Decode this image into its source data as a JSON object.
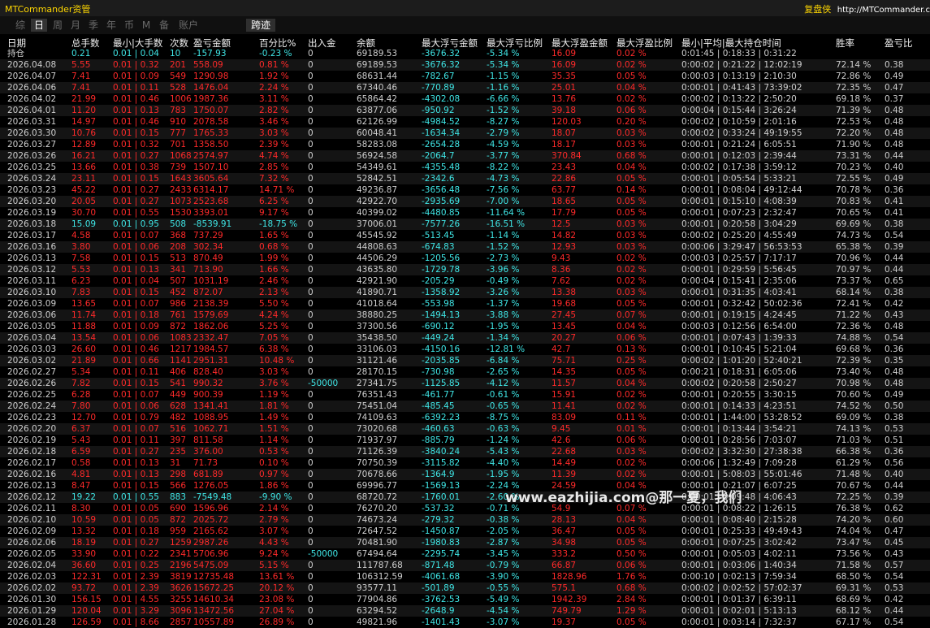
{
  "app": {
    "title": "MTCommander资管",
    "brand": "复盘侠",
    "url": "http://MTCommander.c"
  },
  "toolbar": {
    "timeframes": [
      "综",
      "日",
      "周",
      "月",
      "季",
      "年",
      "币",
      "M",
      "备",
      "账户"
    ],
    "active": "日",
    "selection": "跨迹"
  },
  "colors": {
    "profit": "#ff2a2a",
    "loss": "#3fe6e6",
    "neutral": "#cfcfcf",
    "brand": "#ffd700"
  },
  "columns": [
    "日期",
    "总手数",
    "最小|大手数",
    "次数",
    "盈亏金额",
    "百分比%",
    "出入金",
    "余额",
    "最大浮亏金额",
    "最大浮亏比例",
    "最大浮盈金额",
    "最大浮盈比例",
    "最小|平均|最大持仓时间",
    "胜率",
    "盈亏比"
  ],
  "position_row": [
    "持仓",
    "0.21",
    "0.01 | 0.04",
    "10",
    "-157.93",
    "-0.23 %",
    "0",
    "69189.53",
    "-3676.32",
    "-5.34 %",
    "16.09",
    "0.02 %",
    "0:01:45 | 0:18:33 | 0:31:22",
    "",
    ""
  ],
  "rows": [
    [
      "2026.04.08",
      "5.55",
      "0.01 | 0.32",
      "201",
      "558.09",
      "0.81 %",
      "0",
      "69189.53",
      "-3676.32",
      "-5.34 %",
      "16.09",
      "0.02 %",
      "0:00:02 | 0:21:22 | 12:02:19",
      "72.14 %",
      "0.38"
    ],
    [
      "2026.04.07",
      "7.41",
      "0.01 | 0.09",
      "549",
      "1290.98",
      "1.92 %",
      "0",
      "68631.44",
      "-782.67",
      "-1.15 %",
      "35.35",
      "0.05 %",
      "0:00:03 | 0:13:19 | 2:10:30",
      "72.86 %",
      "0.49"
    ],
    [
      "2026.04.06",
      "7.41",
      "0.01 | 0.11",
      "528",
      "1476.04",
      "2.24 %",
      "0",
      "67340.46",
      "-770.89",
      "-1.16 %",
      "25.01",
      "0.04 %",
      "0:00:01 | 0:41:43 | 73:39:02",
      "72.35 %",
      "0.47"
    ],
    [
      "2026.04.02",
      "21.99",
      "0.01 | 0.46",
      "1006",
      "1987.36",
      "3.11 %",
      "0",
      "65864.42",
      "-4302.08",
      "-6.66 %",
      "13.76",
      "0.02 %",
      "0:00:02 | 0:13:22 | 2:50:20",
      "69.18 %",
      "0.37"
    ],
    [
      "2026.04.01",
      "11.20",
      "0.01 | 0.13",
      "783",
      "1750.07",
      "2.82 %",
      "0",
      "63877.06",
      "-950.92",
      "-1.52 %",
      "39.18",
      "0.06 %",
      "0:00:04 | 0:15:44 | 3:26:24",
      "71.39 %",
      "0.48"
    ],
    [
      "2026.03.31",
      "14.97",
      "0.01 | 0.46",
      "910",
      "2078.58",
      "3.46 %",
      "0",
      "62126.99",
      "-4984.52",
      "-8.27 %",
      "120.03",
      "0.20 %",
      "0:00:02 | 0:10:59 | 2:01:16",
      "72.53 %",
      "0.48"
    ],
    [
      "2026.03.30",
      "10.76",
      "0.01 | 0.15",
      "777",
      "1765.33",
      "3.03 %",
      "0",
      "60048.41",
      "-1634.34",
      "-2.79 %",
      "18.07",
      "0.03 %",
      "0:00:02 | 0:33:24 | 49:19:55",
      "72.20 %",
      "0.48"
    ],
    [
      "2026.03.27",
      "12.89",
      "0.01 | 0.32",
      "701",
      "1358.50",
      "2.39 %",
      "0",
      "58283.08",
      "-2654.28",
      "-4.59 %",
      "18.17",
      "0.03 %",
      "0:00:01 | 0:21:24 | 6:05:51",
      "71.90 %",
      "0.48"
    ],
    [
      "2026.03.26",
      "16.21",
      "0.01 | 0.27",
      "1068",
      "2574.97",
      "4.74 %",
      "0",
      "56924.58",
      "-2064.7",
      "-3.77 %",
      "370.84",
      "0.68 %",
      "0:00:01 | 0:12:03 | 2:39:44",
      "73.31 %",
      "0.44"
    ],
    [
      "2026.03.25",
      "13.66",
      "0.01 | 0.38",
      "739",
      "1507.10",
      "2.85 %",
      "0",
      "54349.61",
      "-4355.48",
      "-8.22 %",
      "23.43",
      "0.04 %",
      "0:00:02 | 0:17:38 | 3:59:12",
      "70.23 %",
      "0.40"
    ],
    [
      "2026.03.24",
      "23.11",
      "0.01 | 0.15",
      "1643",
      "3605.64",
      "7.32 %",
      "0",
      "52842.51",
      "-2342.6",
      "-4.73 %",
      "22.86",
      "0.05 %",
      "0:00:01 | 0:05:54 | 5:33:21",
      "72.55 %",
      "0.49"
    ],
    [
      "2026.03.23",
      "45.22",
      "0.01 | 0.27",
      "2433",
      "6314.17",
      "14.71 %",
      "0",
      "49236.87",
      "-3656.48",
      "-7.56 %",
      "63.77",
      "0.14 %",
      "0:00:01 | 0:08:04 | 49:12:44",
      "70.78 %",
      "0.36"
    ],
    [
      "2026.03.20",
      "20.05",
      "0.01 | 0.27",
      "1073",
      "2523.68",
      "6.25 %",
      "0",
      "42922.70",
      "-2935.69",
      "-7.00 %",
      "18.65",
      "0.05 %",
      "0:00:01 | 0:15:10 | 4:08:39",
      "70.83 %",
      "0.41"
    ],
    [
      "2026.03.19",
      "30.70",
      "0.01 | 0.55",
      "1530",
      "3393.01",
      "9.17 %",
      "0",
      "40399.02",
      "-4480.85",
      "-11.64 %",
      "17.79",
      "0.05 %",
      "0:00:01 | 0:07:23 | 2:32:47",
      "70.65 %",
      "0.41"
    ],
    [
      "2026.03.18",
      "15.09",
      "0.01 | 0.95",
      "508",
      "-8539.91",
      "-18.75 %",
      "0",
      "37006.01",
      "-7577.26",
      "-16.51 %",
      "12.5",
      "0.03 %",
      "0:00:01 | 0:20:58 | 3:04:29",
      "69.69 %",
      "0.38"
    ],
    [
      "2026.03.17",
      "4.58",
      "0.01 | 0.07",
      "368",
      "737.29",
      "1.65 %",
      "0",
      "45545.92",
      "-513.45",
      "-1.14 %",
      "14.82",
      "0.03 %",
      "0:00:02 | 0:25:20 | 4:55:49",
      "74.73 %",
      "0.54"
    ],
    [
      "2026.03.16",
      "3.80",
      "0.01 | 0.06",
      "208",
      "302.34",
      "0.68 %",
      "0",
      "44808.63",
      "-674.83",
      "-1.52 %",
      "12.93",
      "0.03 %",
      "0:00:06 | 3:29:47 | 56:53:53",
      "65.38 %",
      "0.39"
    ],
    [
      "2026.03.13",
      "7.58",
      "0.01 | 0.15",
      "513",
      "870.49",
      "1.99 %",
      "0",
      "44506.29",
      "-1205.56",
      "-2.73 %",
      "9.43",
      "0.02 %",
      "0:00:03 | 0:25:57 | 7:17:17",
      "70.96 %",
      "0.44"
    ],
    [
      "2026.03.12",
      "5.53",
      "0.01 | 0.13",
      "341",
      "713.90",
      "1.66 %",
      "0",
      "43635.80",
      "-1729.78",
      "-3.96 %",
      "8.36",
      "0.02 %",
      "0:00:01 | 0:29:59 | 5:56:45",
      "70.97 %",
      "0.44"
    ],
    [
      "2026.03.11",
      "6.23",
      "0.01 | 0.04",
      "507",
      "1031.19",
      "2.46 %",
      "0",
      "42921.90",
      "-205.29",
      "-0.49 %",
      "7.62",
      "0.02 %",
      "0:00:04 | 0:15:41 | 2:35:06",
      "73.37 %",
      "0.65"
    ],
    [
      "2026.03.10",
      "7.83",
      "0.01 | 0.15",
      "452",
      "872.07",
      "2.13 %",
      "0",
      "41890.71",
      "-1358.92",
      "-3.26 %",
      "13.38",
      "0.03 %",
      "0:00:01 | 0:31:35 | 4:03:41",
      "68.14 %",
      "0.38"
    ],
    [
      "2026.03.09",
      "13.65",
      "0.01 | 0.07",
      "986",
      "2138.39",
      "5.50 %",
      "0",
      "41018.64",
      "-553.98",
      "-1.37 %",
      "19.68",
      "0.05 %",
      "0:00:01 | 0:32:42 | 50:02:36",
      "72.41 %",
      "0.42"
    ],
    [
      "2026.03.06",
      "11.74",
      "0.01 | 0.18",
      "761",
      "1579.69",
      "4.24 %",
      "0",
      "38880.25",
      "-1494.13",
      "-3.88 %",
      "27.45",
      "0.07 %",
      "0:00:01 | 0:19:15 | 4:24:45",
      "71.22 %",
      "0.43"
    ],
    [
      "2026.03.05",
      "11.88",
      "0.01 | 0.09",
      "872",
      "1862.06",
      "5.25 %",
      "0",
      "37300.56",
      "-690.12",
      "-1.95 %",
      "13.45",
      "0.04 %",
      "0:00:03 | 0:12:56 | 6:54:00",
      "72.36 %",
      "0.48"
    ],
    [
      "2026.03.04",
      "13.54",
      "0.01 | 0.06",
      "1083",
      "2332.47",
      "7.05 %",
      "0",
      "35438.50",
      "-449.24",
      "-1.34 %",
      "20.27",
      "0.06 %",
      "0:00:01 | 0:07:43 | 1:39:33",
      "74.88 %",
      "0.54"
    ],
    [
      "2026.03.03",
      "26.60",
      "0.01 | 0.46",
      "1217",
      "1984.57",
      "6.38 %",
      "0",
      "33106.03",
      "-4150.16",
      "-12.81 %",
      "42.7",
      "0.13 %",
      "0:00:01 | 0:10:45 | 5:21:04",
      "69.68 %",
      "0.36"
    ],
    [
      "2026.03.02",
      "21.89",
      "0.01 | 0.66",
      "1141",
      "2951.31",
      "10.48 %",
      "0",
      "31121.46",
      "-2035.85",
      "-6.84 %",
      "75.71",
      "0.25 %",
      "0:00:02 | 1:01:20 | 52:40:21",
      "72.39 %",
      "0.35"
    ],
    [
      "2026.02.27",
      "5.34",
      "0.01 | 0.11",
      "406",
      "828.40",
      "3.03 %",
      "0",
      "28170.15",
      "-730.98",
      "-2.65 %",
      "14.35",
      "0.05 %",
      "0:00:21 | 0:18:31 | 6:05:06",
      "73.40 %",
      "0.48"
    ],
    [
      "2026.02.26",
      "7.82",
      "0.01 | 0.15",
      "541",
      "990.32",
      "3.76 %",
      "-50000",
      "27341.75",
      "-1125.85",
      "-4.12 %",
      "11.57",
      "0.04 %",
      "0:00:02 | 0:20:58 | 2:50:27",
      "70.98 %",
      "0.48"
    ],
    [
      "2026.02.25",
      "6.28",
      "0.01 | 0.07",
      "449",
      "900.39",
      "1.19 %",
      "0",
      "76351.43",
      "-461.77",
      "-0.61 %",
      "15.91",
      "0.02 %",
      "0:00:01 | 0:20:55 | 3:30:15",
      "70.60 %",
      "0.49"
    ],
    [
      "2026.02.24",
      "7.80",
      "0.01 | 0.06",
      "628",
      "1341.41",
      "1.81 %",
      "0",
      "75451.04",
      "-485.45",
      "-0.65 %",
      "11.41",
      "0.02 %",
      "0:00:01 | 0:14:33 | 4:23:51",
      "74.52 %",
      "0.50"
    ],
    [
      "2026.02.23",
      "12.70",
      "0.01 | 0.79",
      "482",
      "1088.95",
      "1.49 %",
      "0",
      "74109.63",
      "-6392.23",
      "-8.75 %",
      "83.09",
      "0.11 %",
      "0:00:01 | 1:44:00 | 53:28:52",
      "69.09 %",
      "0.38"
    ],
    [
      "2026.02.20",
      "6.37",
      "0.01 | 0.07",
      "516",
      "1062.71",
      "1.51 %",
      "0",
      "73020.68",
      "-460.63",
      "-0.63 %",
      "9.45",
      "0.01 %",
      "0:00:01 | 0:13:44 | 3:54:21",
      "74.13 %",
      "0.53"
    ],
    [
      "2026.02.19",
      "5.43",
      "0.01 | 0.11",
      "397",
      "811.58",
      "1.14 %",
      "0",
      "71937.97",
      "-885.79",
      "-1.24 %",
      "42.6",
      "0.06 %",
      "0:00:01 | 0:28:56 | 7:03:07",
      "71.03 %",
      "0.51"
    ],
    [
      "2026.02.18",
      "6.59",
      "0.01 | 0.27",
      "235",
      "376.00",
      "0.53 %",
      "0",
      "71126.39",
      "-3840.24",
      "-5.43 %",
      "22.68",
      "0.03 %",
      "0:00:02 | 3:32:30 | 27:38:38",
      "66.38 %",
      "0.36"
    ],
    [
      "2026.02.17",
      "0.58",
      "0.01 | 0.13",
      "31",
      "71.73",
      "0.10 %",
      "0",
      "70750.39",
      "-3115.82",
      "-4.40 %",
      "14.49",
      "0.02 %",
      "0:00:06 | 1:32:49 | 7:09:28",
      "61.29 %",
      "0.56"
    ],
    [
      "2026.02.16",
      "4.81",
      "0.01 | 0.13",
      "298",
      "681.89",
      "0.97 %",
      "0",
      "70678.66",
      "-1364.9",
      "-1.95 %",
      "11.39",
      "0.02 %",
      "0:00:01 | 5:08:03 | 55:01:46",
      "71.48 %",
      "0.40"
    ],
    [
      "2026.02.13",
      "8.47",
      "0.01 | 0.15",
      "566",
      "1276.05",
      "1.86 %",
      "0",
      "69996.77",
      "-1569.13",
      "-2.24 %",
      "24.59",
      "0.04 %",
      "0:00:01 | 0:21:07 | 6:07:25",
      "70.67 %",
      "0.44"
    ],
    [
      "2026.02.12",
      "19.22",
      "0.01 | 0.55",
      "883",
      "-7549.48",
      "-9.90 %",
      "0",
      "68720.72",
      "-1760.01",
      "-2.60 %",
      "",
      "",
      "0:00:01 | 0:09:48 | 4:06:43",
      "72.25 %",
      "0.39"
    ],
    [
      "2026.02.11",
      "8.30",
      "0.01 | 0.05",
      "690",
      "1596.96",
      "2.14 %",
      "0",
      "76270.20",
      "-537.32",
      "-0.71 %",
      "54.9",
      "0.07 %",
      "0:00:01 | 0:08:22 | 1:26:15",
      "76.38 %",
      "0.62"
    ],
    [
      "2026.02.10",
      "10.59",
      "0.01 | 0.05",
      "872",
      "2025.72",
      "2.79 %",
      "0",
      "74673.24",
      "-279.32",
      "-0.38 %",
      "28.13",
      "0.04 %",
      "0:00:01 | 0:08:40 | 2:15:28",
      "74.20 %",
      "0.60"
    ],
    [
      "2026.02.09",
      "13.32",
      "0.01 | 0.18",
      "959",
      "2165.62",
      "3.07 %",
      "0",
      "72647.52",
      "-1450.87",
      "-2.05 %",
      "36.47",
      "0.05 %",
      "0:00:01 | 0:25:33 | 49:49:43",
      "74.04 %",
      "0.47"
    ],
    [
      "2026.02.06",
      "18.19",
      "0.01 | 0.27",
      "1259",
      "2987.26",
      "4.43 %",
      "0",
      "70481.90",
      "-1980.83",
      "-2.87 %",
      "34.98",
      "0.05 %",
      "0:00:01 | 0:07:25 | 3:02:42",
      "73.47 %",
      "0.45"
    ],
    [
      "2026.02.05",
      "33.90",
      "0.01 | 0.22",
      "2341",
      "5706.96",
      "9.24 %",
      "-50000",
      "67494.64",
      "-2295.74",
      "-3.45 %",
      "333.2",
      "0.50 %",
      "0:00:01 | 0:05:03 | 4:02:11",
      "73.56 %",
      "0.43"
    ],
    [
      "2026.02.04",
      "36.60",
      "0.01 | 0.25",
      "2196",
      "5475.09",
      "5.15 %",
      "0",
      "111787.68",
      "-871.48",
      "-0.79 %",
      "66.87",
      "0.06 %",
      "0:00:01 | 0:03:06 | 1:40:34",
      "71.58 %",
      "0.57"
    ],
    [
      "2026.02.03",
      "122.31",
      "0.01 | 2.39",
      "3819",
      "12735.48",
      "13.61 %",
      "0",
      "106312.59",
      "-4061.68",
      "-3.90 %",
      "1828.96",
      "1.76 %",
      "0:00:10 | 0:02:13 | 7:59:34",
      "68.50 %",
      "0.54"
    ],
    [
      "2026.02.02",
      "93.72",
      "0.01 | 2.39",
      "3626",
      "15672.25",
      "20.12 %",
      "0",
      "93577.11",
      "-501.89",
      "-0.55 %",
      "575.1",
      "0.68 %",
      "0:00:02 | 0:02:52 | 57:02:37",
      "69.31 %",
      "0.53"
    ],
    [
      "2026.01.30",
      "156.15",
      "0.01 | 4.55",
      "3255",
      "14610.34",
      "23.08 %",
      "0",
      "77904.86",
      "-3762.53",
      "-5.49 %",
      "1942.39",
      "2.84 %",
      "0:00:01 | 0:01:37 | 6:39:11",
      "68.69 %",
      "0.42"
    ],
    [
      "2026.01.29",
      "120.04",
      "0.01 | 3.29",
      "3096",
      "13472.56",
      "27.04 %",
      "0",
      "63294.52",
      "-2648.9",
      "-4.54 %",
      "749.79",
      "1.29 %",
      "0:00:01 | 0:02:01 | 5:13:13",
      "68.12 %",
      "0.44"
    ],
    [
      "2026.01.28",
      "126.59",
      "0.01 | 8.66",
      "2857",
      "10557.89",
      "26.89 %",
      "0",
      "49821.96",
      "-1401.43",
      "-3.07 %",
      "19.37",
      "0.05 %",
      "0:00:01 | 0:03:14 | 7:32:37",
      "67.17 %",
      "0.54"
    ]
  ],
  "watermark": "www.eazhijia.com@那一夏，我们"
}
